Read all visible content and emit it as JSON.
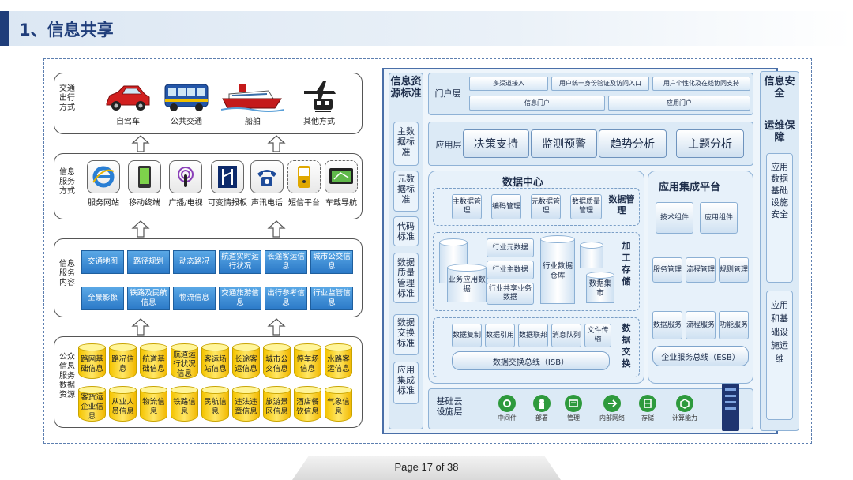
{
  "header": {
    "title": "1、信息共享"
  },
  "left": {
    "vehicles": {
      "label": "交通出行方式",
      "items": [
        "自驾车",
        "公共交通",
        "船舶",
        "其他方式"
      ]
    },
    "services": {
      "label": "信息服务方式",
      "items": [
        "服务网站",
        "移动终端",
        "广播/电视",
        "可变情报板",
        "声讯电话",
        "短信平台",
        "车载导航"
      ]
    },
    "content": {
      "label": "信息服务内容",
      "row1": [
        "交通地图",
        "路径规划",
        "动态路况",
        "航道实时运行状况",
        "长途客运信息",
        "城市公交信息"
      ],
      "row2": [
        "全景影像",
        "铁路及民航信息",
        "物流信息",
        "交通旅游信息",
        "出行参考信息",
        "行业监管信息"
      ]
    },
    "resources": {
      "label": "公众信息服务数据资源",
      "row1": [
        "路网基础信息",
        "路况信息",
        "航道基础信息",
        "航道运行状况信息",
        "客运场站信息",
        "长途客运信息",
        "城市公交信息",
        "停车场信息",
        "水路客运信息"
      ],
      "row2": [
        "客货运企业信息",
        "从业人员信息",
        "物流信息",
        "铁路信息",
        "民航信息",
        "违法违章信息",
        "旅游景区信息",
        "酒店餐饮信息",
        "气象信息"
      ]
    }
  },
  "right": {
    "left_col": {
      "title": "信息资源标准",
      "items": [
        "主数据标准",
        "元数据标准",
        "代码标准",
        "数据质量管理标准",
        "数据交换标准",
        "应用集成标准"
      ]
    },
    "portal": {
      "label": "门户层",
      "row1": [
        "多渠道接入",
        "用户统一身份验证及访问入口",
        "用户个性化及在线协同支持"
      ],
      "row2": [
        "信息门户",
        "应用门户"
      ]
    },
    "app_layer": {
      "label": "应用层",
      "items": [
        "决策支持",
        "监测预警",
        "趋势分析",
        "主题分析"
      ]
    },
    "data_center": {
      "title": "数据中心",
      "mgmt_label": "数据管理",
      "mgmt_items": [
        "主数据管理",
        "编码管理",
        "元数据管理",
        "数据质量管理"
      ],
      "storage_label": "加工存储",
      "storage_items": [
        "行业元数据",
        "行业主数据",
        "行业共享业务数据",
        "业务应用数据",
        "行业数据仓库",
        "数据集市"
      ],
      "exchange_label": "数据交换",
      "exchange_items": [
        "数据复制",
        "数据引用",
        "数据联邦",
        "消息队列",
        "文件传输"
      ],
      "exchange_bus": "数据交换总线（ISB）"
    },
    "app_integration": {
      "title": "应用集成平台",
      "row1": [
        "技术组件",
        "应用组件"
      ],
      "row2": [
        "服务管理",
        "流程管理",
        "规则管理"
      ],
      "row3": [
        "数据服务",
        "流程服务",
        "功能服务"
      ],
      "bus": "企业服务总线（ESB）"
    },
    "infra": {
      "label": "基础云设施层",
      "items": [
        "中间件",
        "部署",
        "管理",
        "内部网络",
        "存储",
        "计算能力"
      ]
    },
    "right_col": {
      "title1": "信息安全",
      "title2": "运维保障",
      "box1": "应用数据基础设施安全",
      "box2": "应用和基础设施运维"
    }
  },
  "footer": {
    "page": "Page 17 of 38"
  },
  "colors": {
    "accent": "#1f3d7a",
    "button_blue": "#2b79c7",
    "data_yellow": "#f5c400",
    "infra_green": "#2e9a3d"
  }
}
